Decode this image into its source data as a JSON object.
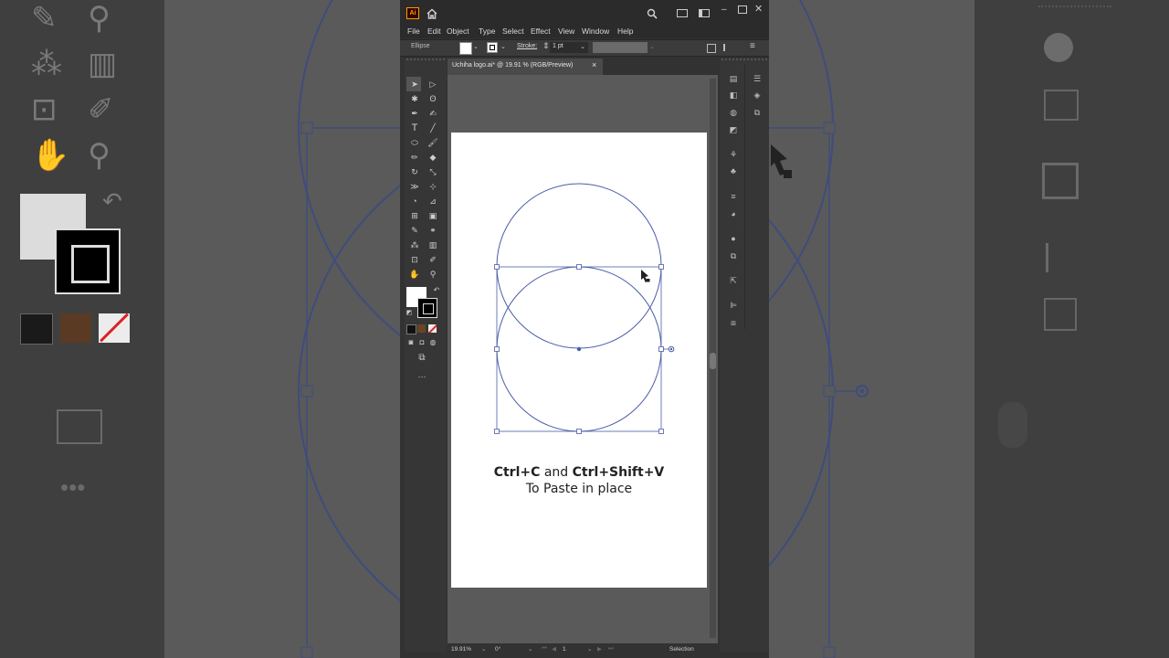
{
  "app": {
    "logo": "Ai",
    "menus": [
      "File",
      "Edit",
      "Object",
      "Type",
      "Select",
      "Effect",
      "View",
      "Window",
      "Help"
    ],
    "control_bar": {
      "object_label": "Ellipse",
      "stroke_label": "Stroke:",
      "stroke_value": "1 pt"
    },
    "document_tab": {
      "title": "Uchiha logo.ai* @ 19.91 % (RGB/Preview)",
      "close": "×"
    },
    "status_bar": {
      "zoom": "19.91%",
      "rotation": "0°",
      "artboard_number": "1",
      "tool": "Selection"
    },
    "more_tools": "···"
  },
  "artboard": {
    "caption_line1": {
      "key1": "Ctrl+C",
      "connector": " and ",
      "key2": "Ctrl+Shift+V"
    },
    "caption_line2": "To Paste in place"
  },
  "colors": {
    "selection_blue": "#4a5ca8",
    "window_dark": "#323232",
    "canvas_gray": "#5a5a5a"
  },
  "icons": {
    "tools": [
      "selection",
      "direct-selection",
      "magic-wand",
      "lasso",
      "pen",
      "curvature",
      "type",
      "line",
      "ellipse",
      "paintbrush",
      "pencil",
      "eraser",
      "rotate",
      "scale",
      "width",
      "free-transform",
      "shape-builder",
      "perspective",
      "mesh",
      "gradient",
      "eyedropper",
      "blend",
      "symbol-sprayer",
      "graph",
      "artboard",
      "slice",
      "hand",
      "zoom"
    ],
    "panels": [
      "properties",
      "layers",
      "libraries",
      "color",
      "gradient",
      "swatches",
      "brushes",
      "symbols",
      "stroke",
      "transparency",
      "appearance",
      "graphic-styles",
      "export",
      "align",
      "pathfinder"
    ]
  }
}
